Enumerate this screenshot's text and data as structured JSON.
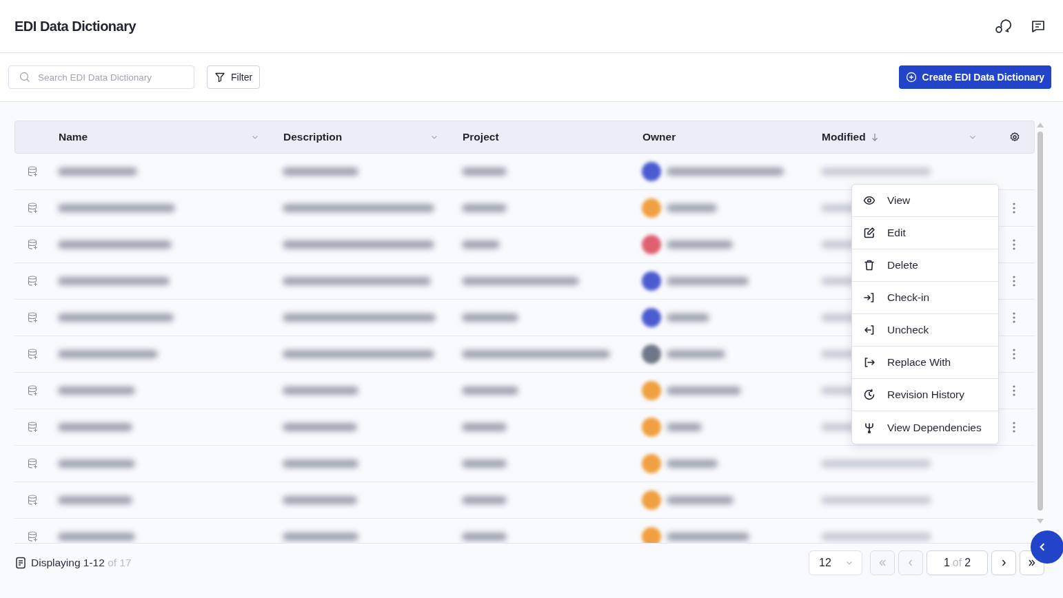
{
  "header": {
    "title": "EDI Data Dictionary"
  },
  "toolbar": {
    "search": {
      "placeholder": "Search EDI Data Dictionary"
    },
    "filter_button": "Filter",
    "create_button": "Create EDI Data Dictionary"
  },
  "table": {
    "columns": [
      {
        "label": "Name",
        "kind": "dropdown"
      },
      {
        "label": "Description",
        "kind": "dropdown"
      },
      {
        "label": "Project",
        "kind": "plain"
      },
      {
        "label": "Owner",
        "kind": "plain"
      },
      {
        "label": "Modified",
        "kind": "sorted"
      }
    ],
    "rows": [
      {
        "menu_button": false
      },
      {
        "menu_button": true
      },
      {
        "menu_button": true
      },
      {
        "menu_button": true
      },
      {
        "menu_button": true
      },
      {
        "menu_button": true
      },
      {
        "menu_button": true
      },
      {
        "menu_button": true
      },
      {
        "menu_button": false
      },
      {
        "menu_button": false
      },
      {
        "menu_button": false
      }
    ]
  },
  "row_menu": {
    "items": [
      {
        "label": "View",
        "kind": "view"
      },
      {
        "label": "Edit",
        "kind": "edit"
      },
      {
        "label": "Delete",
        "kind": "delete"
      },
      {
        "label": "Check-in",
        "kind": "checkin"
      },
      {
        "label": "Uncheck",
        "kind": "uncheck"
      },
      {
        "label": "Replace With",
        "kind": "replace"
      },
      {
        "label": "Revision History",
        "kind": "history"
      },
      {
        "label": "View Dependencies",
        "kind": "dependencies"
      }
    ]
  },
  "footer": {
    "display_range": "Displaying 1-12",
    "display_total": "of 17",
    "page_size": "12",
    "page_current": "1",
    "page_of": "of",
    "page_total": "2",
    "pager": [
      {
        "kind": "first",
        "disabled": true
      },
      {
        "kind": "prev",
        "disabled": true
      },
      {
        "kind": "page"
      },
      {
        "kind": "next",
        "disabled": false
      },
      {
        "kind": "last",
        "disabled": false
      }
    ]
  }
}
